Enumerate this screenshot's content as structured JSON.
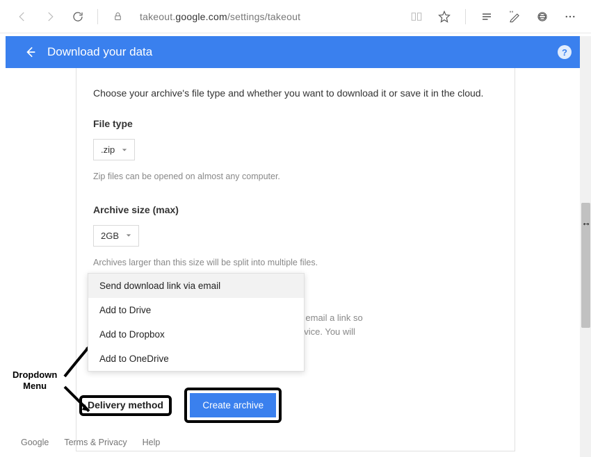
{
  "browser": {
    "url_prefix": "takeout.",
    "url_domain": "google.com",
    "url_path": "/settings/takeout"
  },
  "header": {
    "title": "Download your data"
  },
  "intro": "Choose your archive's file type and whether you want to download it or save it in the cloud.",
  "file_type": {
    "label": "File type",
    "value": ".zip",
    "hint": "Zip files can be opened on almost any computer."
  },
  "archive_size": {
    "label": "Archive size (max)",
    "value": "2GB",
    "hint": "Archives larger than this size will be split into multiple files."
  },
  "delivery": {
    "label": "Delivery method",
    "options": [
      "Send download link via email",
      "Add to Drive",
      "Add to Dropbox",
      "Add to OneDrive"
    ],
    "side_text_1": "ll email a link so",
    "side_text_2": "evice. You will"
  },
  "create_button": "Create archive",
  "footer": {
    "google": "Google",
    "terms": "Terms & Privacy",
    "help": "Help"
  },
  "annotation": {
    "label_line1": "Dropdown",
    "label_line2": "Menu"
  }
}
